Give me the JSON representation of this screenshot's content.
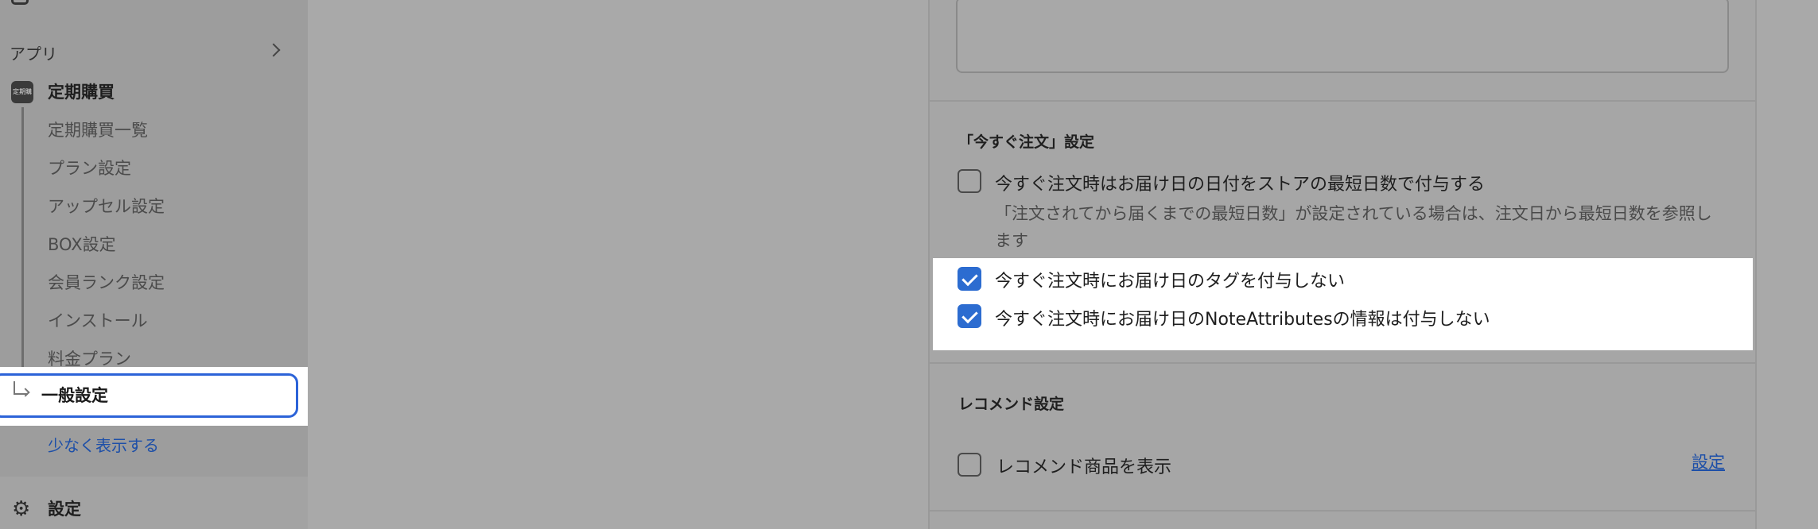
{
  "sidebar": {
    "apps_label": "アプリ",
    "app": {
      "icon_text": "定期購買",
      "name": "定期購買",
      "items": [
        {
          "label": "定期購買一覧"
        },
        {
          "label": "プラン設定"
        },
        {
          "label": "アップセル設定"
        },
        {
          "label": "BOX設定"
        },
        {
          "label": "会員ランク設定"
        },
        {
          "label": "インストール"
        },
        {
          "label": "料金プラン"
        }
      ],
      "active_item": "一般設定",
      "show_less": "少なく表示する"
    },
    "settings_label": "設定"
  },
  "order_now": {
    "title": "「今すぐ注文」設定",
    "options": [
      {
        "label": "今すぐ注文時はお届け日の日付をストアの最短日数で付与する",
        "checked": false,
        "help": "「注文されてから届くまでの最短日数」が設定されている場合は、注文日から最短日数を参照します"
      },
      {
        "label": "今すぐ注文時にお届け日のタグを付与しない",
        "checked": true
      },
      {
        "label": "今すぐ注文時にお届け日のNoteAttributesの情報は付与しない",
        "checked": true
      }
    ]
  },
  "recommend": {
    "title": "レコメンド設定",
    "option_label": "レコメンド商品を表示",
    "option_checked": false,
    "settings_link": "設定"
  },
  "colors": {
    "accent": "#2c6cd0",
    "link": "#1d4fa8",
    "overlay": "#a9a9a9"
  }
}
